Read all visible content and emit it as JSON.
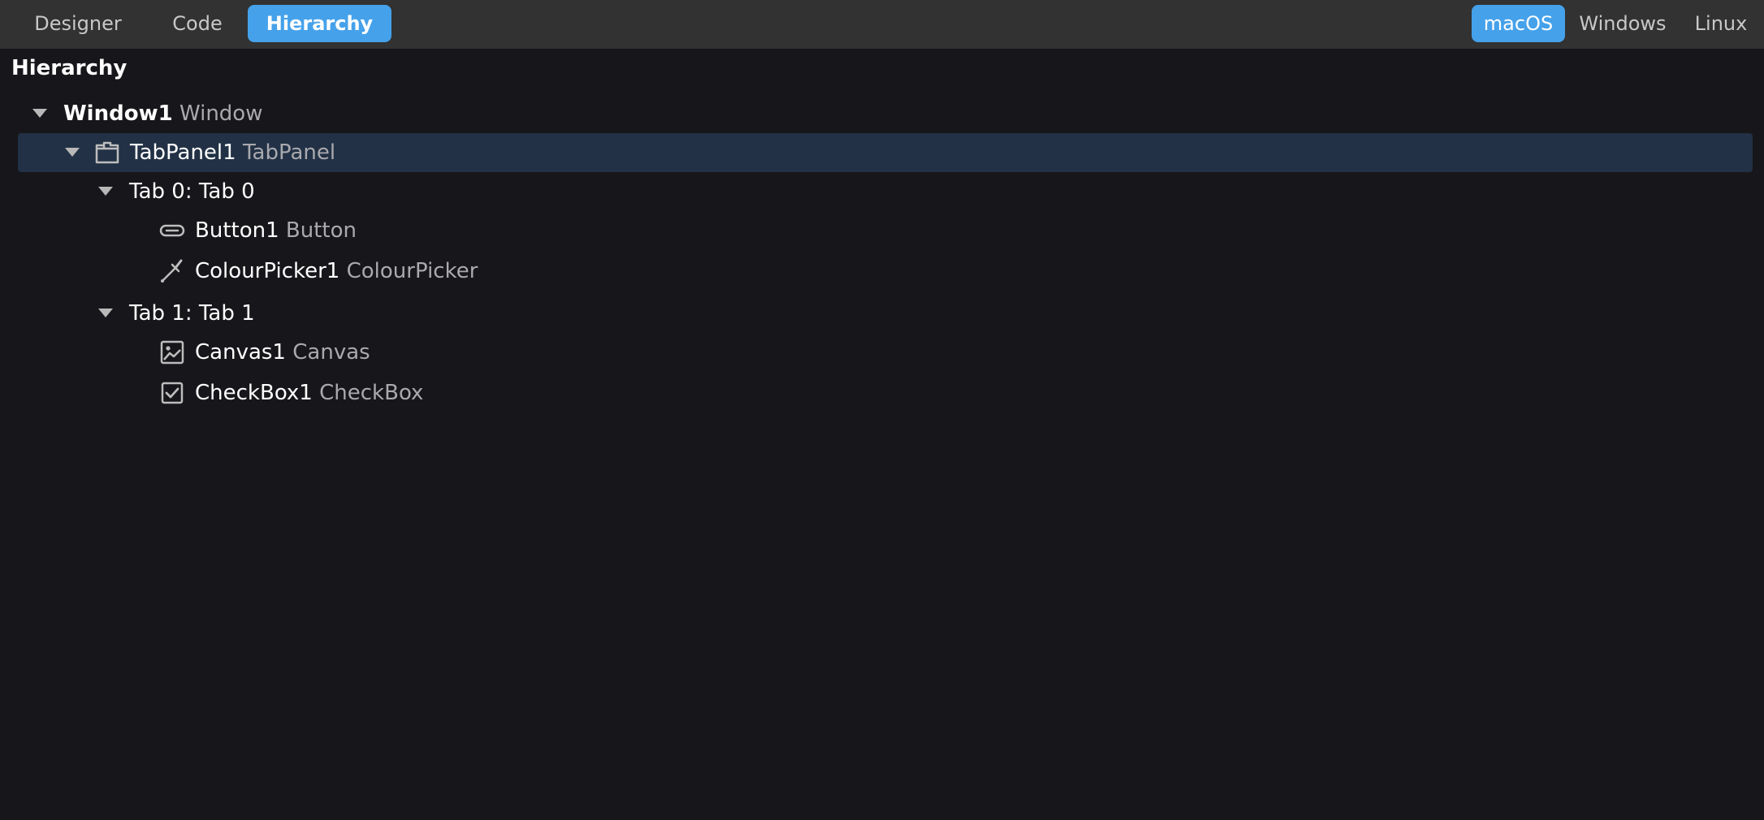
{
  "toolbar": {
    "view_tabs": [
      {
        "label": "Designer",
        "active": false
      },
      {
        "label": "Code",
        "active": false
      },
      {
        "label": "Hierarchy",
        "active": true
      }
    ],
    "platform_tabs": [
      {
        "label": "macOS",
        "active": true
      },
      {
        "label": "Windows",
        "active": false
      },
      {
        "label": "Linux",
        "active": false
      }
    ]
  },
  "panel": {
    "title": "Hierarchy"
  },
  "tree": {
    "window": {
      "name": "Window1",
      "type": "Window",
      "expanded": true
    },
    "tabpanel": {
      "name": "TabPanel1",
      "type": "TabPanel",
      "expanded": true,
      "selected": true,
      "icon": "tabpanel-icon"
    },
    "tab0": {
      "label": "Tab 0: Tab 0",
      "expanded": true
    },
    "button1": {
      "name": "Button1",
      "type": "Button",
      "icon": "button-icon"
    },
    "colourpicker1": {
      "name": "ColourPicker1",
      "type": "ColourPicker",
      "icon": "eyedropper-icon"
    },
    "tab1": {
      "label": "Tab 1: Tab 1",
      "expanded": true
    },
    "canvas1": {
      "name": "Canvas1",
      "type": "Canvas",
      "icon": "image-icon"
    },
    "checkbox1": {
      "name": "CheckBox1",
      "type": "CheckBox",
      "icon": "checkbox-icon"
    }
  },
  "colors": {
    "accent": "#45a1ea",
    "background": "#17171b",
    "topbar": "#323232",
    "selection": "#223145"
  }
}
